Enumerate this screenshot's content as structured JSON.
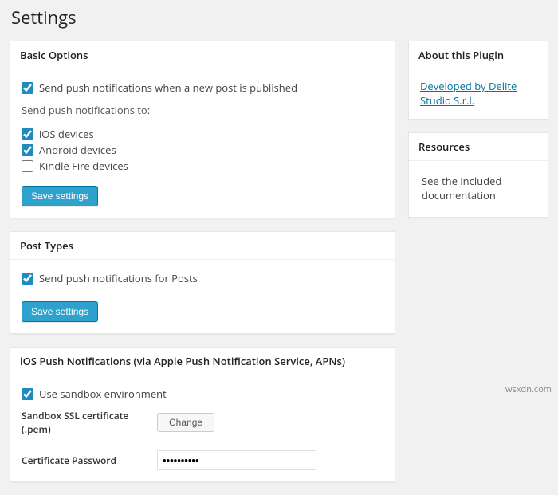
{
  "page": {
    "title": "Settings"
  },
  "basic": {
    "heading": "Basic Options",
    "send_on_publish": "Send push notifications when a new post is published",
    "send_to_label": "Send push notifications to:",
    "ios": "iOS devices",
    "android": "Android devices",
    "kindle": "Kindle Fire devices",
    "save": "Save settings"
  },
  "post_types": {
    "heading": "Post Types",
    "posts": "Send push notifications for Posts",
    "save": "Save settings"
  },
  "ios_push": {
    "heading": "iOS Push Notifications (via Apple Push Notification Service, APNs)",
    "sandbox": "Use sandbox environment",
    "cert_label": "Sandbox SSL certificate (.pem)",
    "change": "Change",
    "pwd_label": "Certificate Password",
    "pwd_value": "••••••••••"
  },
  "sidebar": {
    "about_heading": "About this Plugin",
    "about_link": "Developed by Delite Studio S.r.l.",
    "resources_heading": "Resources",
    "resources_text": "See the included documentation"
  },
  "watermark": "wsxdn.com"
}
